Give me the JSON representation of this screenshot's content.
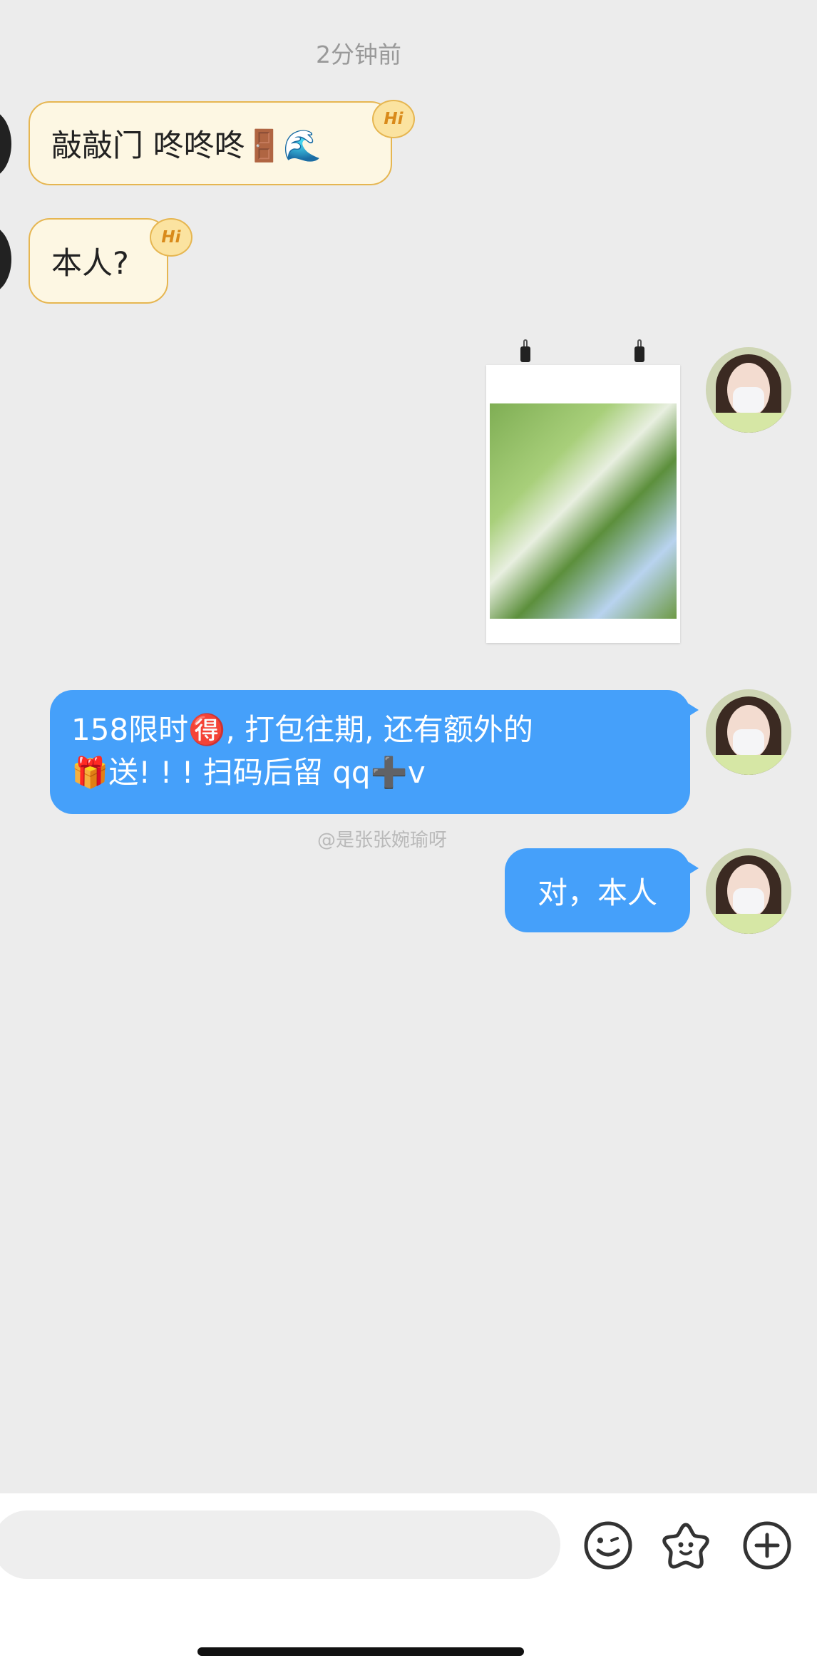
{
  "timestamp": "2分钟前",
  "messages_in": [
    {
      "text": "敲敲门 咚咚咚🚪🌊",
      "badge": "Hi"
    },
    {
      "text": "本人?",
      "badge": "Hi"
    }
  ],
  "messages_out": [
    {
      "line1": "158限时🉐, 打包往期, 还有额外的",
      "line2": "🎁送! ! ! 扫码后留 qq➕v"
    },
    {
      "text": "对，本人"
    }
  ],
  "watermark": "@是张张婉瑜呀",
  "icons": {
    "emoji": "smiley-icon",
    "sticker": "star-face-icon",
    "more": "plus-circle-icon"
  },
  "colors": {
    "incoming_bubble": "#fdf7e3",
    "incoming_border": "#e6b651",
    "outgoing_bubble": "#45a0fa",
    "background": "#ececec"
  }
}
